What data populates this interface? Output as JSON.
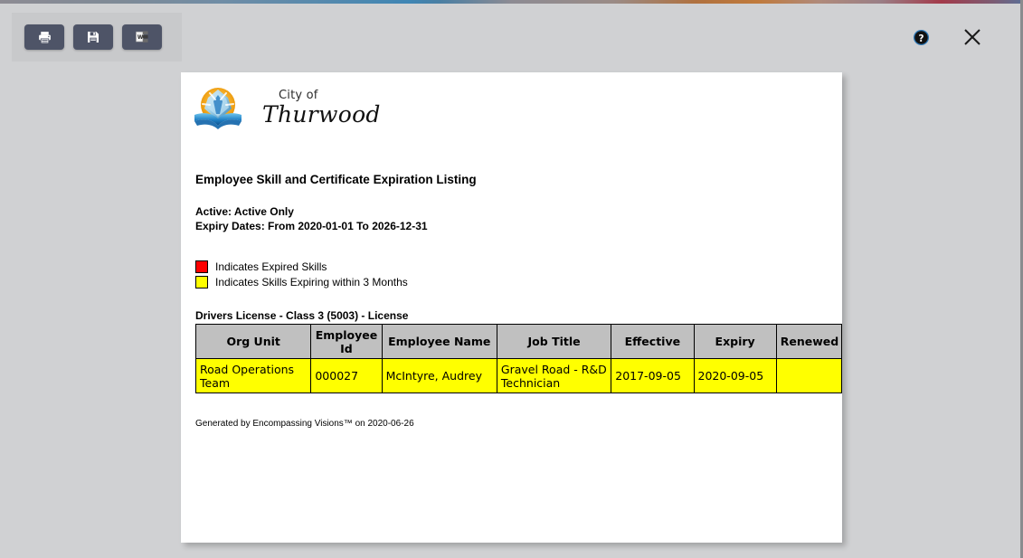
{
  "window": {
    "help_icon": "help-circle-icon",
    "close_icon": "close-x-icon",
    "help_label": "?",
    "close_label": "✕"
  },
  "toolbar": {
    "buttons": [
      {
        "name": "print-button",
        "icon": "printer-icon",
        "label": "Print"
      },
      {
        "name": "save-button",
        "icon": "floppy-disk-icon",
        "label": "Save"
      },
      {
        "name": "export-word-button",
        "icon": "word-document-icon",
        "label": "Export to Word"
      }
    ]
  },
  "logo": {
    "line1": "City of",
    "line2": "Thurwood",
    "mark": "globe-book-logo-icon"
  },
  "report": {
    "title": "Employee Skill and Certificate Expiration Listing",
    "meta": [
      "Active: Active Only",
      "Expiry Dates: From 2020-01-01 To 2026-12-31"
    ],
    "legend": [
      {
        "color": "#ff0000",
        "label": "Indicates Expired Skills"
      },
      {
        "color": "#ffff00",
        "label": "Indicates Skills Expiring within 3 Months"
      }
    ],
    "section_heading": "Drivers License - Class 3 (5003) - License",
    "columns": [
      "Org Unit",
      "Employee Id",
      "Employee Name",
      "Job Title",
      "Effective",
      "Expiry",
      "Renewed"
    ],
    "rows": [
      {
        "org_unit": "Road Operations Team",
        "employee_id": "000027",
        "employee_name": "McIntyre, Audrey",
        "job_title": "Gravel Road - R&D Technician",
        "effective": "2017-09-05",
        "expiry": "2020-09-05",
        "renewed": "",
        "highlight": "#ffff00"
      }
    ],
    "footer": "Generated by Encompassing Visions™ on 2020-06-26"
  }
}
